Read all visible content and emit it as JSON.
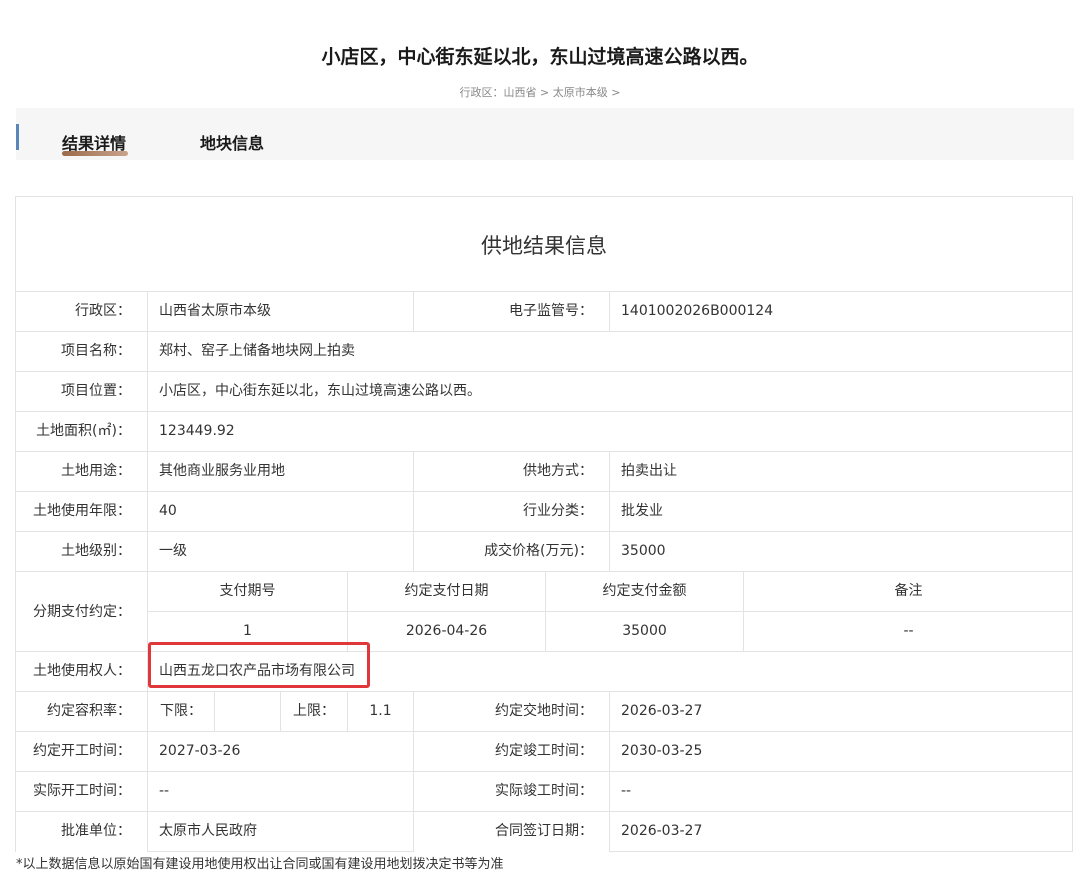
{
  "header": {
    "title": "小店区，中心街东延以北，东山过境高速公路以西。",
    "breadcrumb": "行政区：山西省 > 太原市本级 >"
  },
  "tabs": [
    {
      "label": "结果详情",
      "active": true
    },
    {
      "label": "地块信息",
      "active": false
    }
  ],
  "section_title": "供地结果信息",
  "fields": {
    "district_label": "行政区：",
    "district": "山西省太原市本级",
    "supervision_no_label": "电子监管号：",
    "supervision_no": "1401002026B000124",
    "project_name_label": "项目名称：",
    "project_name": "郑村、窑子上储备地块网上拍卖",
    "location_label": "项目位置：",
    "location": "小店区，中心街东延以北，东山过境高速公路以西。",
    "area_label": "土地面积(㎡)：",
    "area": "123449.92",
    "land_use_label": "土地用途：",
    "land_use": "其他商业服务业用地",
    "supply_method_label": "供地方式：",
    "supply_method": "拍卖出让",
    "term_label": "土地使用年限：",
    "term": "40",
    "industry_label": "行业分类：",
    "industry": "批发业",
    "grade_label": "土地级别：",
    "grade": "一级",
    "price_label": "成交价格(万元)：",
    "price": "35000",
    "installment_label": "分期支付约定：",
    "owner_label": "土地使用权人：",
    "owner": "山西五龙口农产品市场有限公司",
    "far_label": "约定容积率：",
    "far_lower_label": "下限：",
    "far_lower": "",
    "far_upper_label": "上限：",
    "far_upper": "1.1",
    "delivery_label": "约定交地时间：",
    "delivery": "2026-03-27",
    "start_label": "约定开工时间：",
    "start": "2027-03-26",
    "finish_label": "约定竣工时间：",
    "finish": "2030-03-25",
    "actual_start_label": "实际开工时间：",
    "actual_start": "--",
    "actual_finish_label": "实际竣工时间：",
    "actual_finish": "--",
    "approver_label": "批准单位：",
    "approver": "太原市人民政府",
    "contract_date_label": "合同签订日期：",
    "contract_date": "2026-03-27"
  },
  "installment_table": {
    "headers": [
      "支付期号",
      "约定支付日期",
      "约定支付金额",
      "备注"
    ],
    "rows": [
      [
        "1",
        "2026-04-26",
        "35000",
        "--"
      ]
    ]
  },
  "highlight_color": "#e0373a",
  "footnote": "*以上数据信息以原始国有建设用地使用权出让合同或国有建设用地划拨决定书等为准"
}
